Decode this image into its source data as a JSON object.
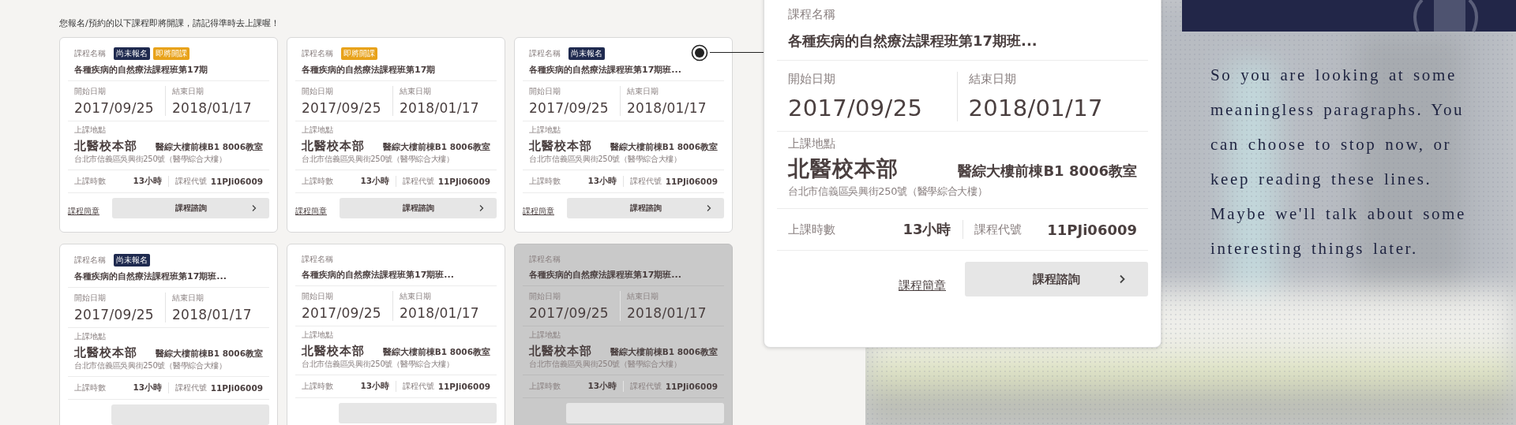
{
  "notice": "您報名/預約的以下課程即將開課，請記得準時去上課喔！",
  "cards": [
    {
      "name_label": "課程名稱",
      "badges": [
        {
          "label": "尚未報名",
          "kind": "unregistered"
        },
        {
          "label": "即將開課",
          "kind": "starting"
        }
      ],
      "title": "各種疾病的自然療法課程班第17期",
      "start_label": "開始日期",
      "start": "2017/09/25",
      "end_label": "結束日期",
      "end": "2018/01/17",
      "place_label": "上課地點",
      "campus": "北醫校本部",
      "room": "醫綜大樓前棟B1 8006教室",
      "address": "台北市信義區吳興街250號（醫學綜合大樓）",
      "hours_label": "上課時數",
      "hours": "13小時",
      "code_label": "課程代號",
      "code": "11PJi06009",
      "link": "課程簡章",
      "button": "課程諮詢",
      "highlighted": false,
      "disabled": false
    },
    {
      "name_label": "課程名稱",
      "badges": [
        {
          "label": "即將開課",
          "kind": "starting"
        }
      ],
      "title": "各種疾病的自然療法課程班第17期",
      "start_label": "開始日期",
      "start": "2017/09/25",
      "end_label": "結束日期",
      "end": "2018/01/17",
      "place_label": "上課地點",
      "campus": "北醫校本部",
      "room": "醫綜大樓前棟B1 8006教室",
      "address": "台北市信義區吳興街250號（醫學綜合大樓）",
      "hours_label": "上課時數",
      "hours": "13小時",
      "code_label": "課程代號",
      "code": "11PJi06009",
      "link": "課程簡章",
      "button": "課程諮詢",
      "highlighted": false,
      "disabled": false
    },
    {
      "name_label": "課程名稱",
      "badges": [
        {
          "label": "尚未報名",
          "kind": "unregistered"
        }
      ],
      "title": "各種疾病的自然療法課程班第17期班...",
      "start_label": "開始日期",
      "start": "2017/09/25",
      "end_label": "結束日期",
      "end": "2018/01/17",
      "place_label": "上課地點",
      "campus": "北醫校本部",
      "room": "醫綜大樓前棟B1 8006教室",
      "address": "台北市信義區吳興街250號（醫學綜合大樓）",
      "hours_label": "上課時數",
      "hours": "13小時",
      "code_label": "課程代號",
      "code": "11PJi06009",
      "link": "課程簡章",
      "button": "課程諮詢",
      "highlighted": true,
      "disabled": false
    },
    {
      "name_label": "課程名稱",
      "badges": [
        {
          "label": "尚未報名",
          "kind": "unregistered"
        }
      ],
      "title": "各種疾病的自然療法課程班第17期班...",
      "start_label": "開始日期",
      "start": "2017/09/25",
      "end_label": "結束日期",
      "end": "2018/01/17",
      "place_label": "上課地點",
      "campus": "北醫校本部",
      "room": "醫綜大樓前棟B1 8006教室",
      "address": "台北市信義區吳興街250號（醫學綜合大樓）",
      "hours_label": "上課時數",
      "hours": "13小時",
      "code_label": "課程代號",
      "code": "11PJi06009",
      "highlighted": false,
      "disabled": false
    },
    {
      "name_label": "課程名稱",
      "title": "各種疾病的自然療法課程班第17期班...",
      "start_label": "開始日期",
      "start": "2017/09/25",
      "end_label": "結束日期",
      "end": "2018/01/17",
      "place_label": "上課地點",
      "campus": "北醫校本部",
      "room": "醫綜大樓前棟B1 8006教室",
      "address": "台北市信義區吳興街250號（醫學綜合大樓）",
      "hours_label": "上課時數",
      "hours": "13小時",
      "code_label": "課程代號",
      "code": "11PJi06009",
      "highlighted": false,
      "disabled": false
    },
    {
      "name_label": "課程名稱",
      "title": "各種疾病的自然療法課程班第17期班...",
      "start_label": "開始日期",
      "start": "2017/09/25",
      "end_label": "結束日期",
      "end": "2018/01/17",
      "place_label": "上課地點",
      "campus": "北醫校本部",
      "room": "醫綜大樓前棟B1 8006教室",
      "address": "台北市信義區吳興街250號（醫學綜合大樓）",
      "hours_label": "上課時數",
      "hours": "13小時",
      "code_label": "課程代號",
      "code": "11PJi06009",
      "highlighted": false,
      "disabled": true
    }
  ],
  "detail": {
    "name_label": "課程名稱",
    "title": "各種疾病的自然療法課程班第17期班...",
    "start_label": "開始日期",
    "start": "2017/09/25",
    "end_label": "結束日期",
    "end": "2018/01/17",
    "place_label": "上課地點",
    "campus": "北醫校本部",
    "room": "醫綜大樓前棟B1 8006教室",
    "address": "台北市信義區吳興街250號（醫學綜合大樓）",
    "hours_label": "上課時數",
    "hours": "13小時",
    "code_label": "課程代號",
    "code": "11PJi06009",
    "link": "課程簡章",
    "button": "課程諮詢"
  },
  "side_text": "So you are looking at some meaningless paragraphs. You can choose to stop now, or keep reading these lines. Maybe we'll talk about some interesting things later."
}
